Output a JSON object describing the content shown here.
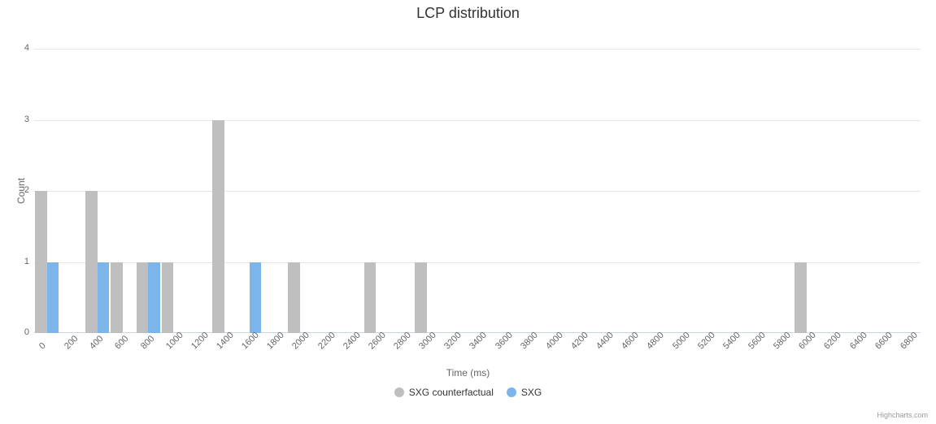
{
  "chart_data": {
    "type": "bar",
    "title": "LCP distribution",
    "xlabel": "Time (ms)",
    "ylabel": "Count",
    "ylim": [
      0,
      4
    ],
    "categories": [
      "0",
      "200",
      "400",
      "600",
      "800",
      "1000",
      "1200",
      "1400",
      "1600",
      "1800",
      "2000",
      "2200",
      "2400",
      "2600",
      "2800",
      "3000",
      "3200",
      "3400",
      "3600",
      "3800",
      "4000",
      "4200",
      "4400",
      "4600",
      "4800",
      "5000",
      "5200",
      "5400",
      "5600",
      "5800",
      "6000",
      "6200",
      "6400",
      "6600",
      "6800"
    ],
    "series": [
      {
        "name": "SXG counterfactual",
        "color": "#bfbfbf",
        "values": [
          2,
          0,
          2,
          1,
          1,
          1,
          0,
          3,
          0,
          0,
          1,
          0,
          0,
          1,
          0,
          1,
          0,
          0,
          0,
          0,
          0,
          0,
          0,
          0,
          0,
          0,
          0,
          0,
          0,
          0,
          1,
          0,
          0,
          0,
          0
        ]
      },
      {
        "name": "SXG",
        "color": "#7cb5ec",
        "values": [
          1,
          0,
          1,
          0,
          1,
          0,
          0,
          0,
          1,
          0,
          0,
          0,
          0,
          0,
          0,
          0,
          0,
          0,
          0,
          0,
          0,
          0,
          0,
          0,
          0,
          0,
          0,
          0,
          0,
          0,
          0,
          0,
          0,
          0,
          0
        ]
      }
    ],
    "credits": "Highcharts.com"
  }
}
